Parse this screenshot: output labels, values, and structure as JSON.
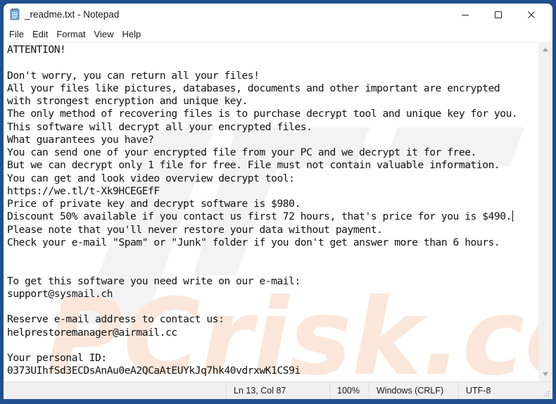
{
  "window": {
    "title": "_readme.txt - Notepad",
    "app_icon": "notepad-icon",
    "controls": {
      "minimize": "minimize-icon",
      "maximize": "maximize-icon",
      "close": "close-icon"
    }
  },
  "menu": {
    "items": [
      "File",
      "Edit",
      "Format",
      "View",
      "Help"
    ]
  },
  "document": {
    "lines": [
      "ATTENTION!",
      "",
      "Don't worry, you can return all your files!",
      "All your files like pictures, databases, documents and other important are encrypted",
      "with strongest encryption and unique key.",
      "The only method of recovering files is to purchase decrypt tool and unique key for you.",
      "This software will decrypt all your encrypted files.",
      "What guarantees you have?",
      "You can send one of your encrypted file from your PC and we decrypt it for free.",
      "But we can decrypt only 1 file for free. File must not contain valuable information.",
      "You can get and look video overview decrypt tool:",
      "https://we.tl/t-Xk9HCEGEfF",
      "Price of private key and decrypt software is $980.",
      "Discount 50% available if you contact us first 72 hours, that's price for you is $490.",
      "Please note that you'll never restore your data without payment.",
      "Check your e-mail \"Spam\" or \"Junk\" folder if you don't get answer more than 6 hours.",
      "",
      "",
      "To get this software you need write on our e-mail:",
      "support@sysmail.ch",
      "",
      "Reserve e-mail address to contact us:",
      "helprestoremanager@airmail.cc",
      "",
      "Your personal ID:",
      "0373UIhfSd3ECDsAnAu0eA2QCaAtEUYkJq7hk40vdrxwK1CS9i"
    ],
    "caret_line_index": 13,
    "watermark_text": "PCrisk.com"
  },
  "statusbar": {
    "position": "Ln 13, Col 87",
    "zoom": "100%",
    "line_ending": "Windows (CRLF)",
    "encoding": "UTF-8"
  },
  "colors": {
    "desktop_background": "#1f4f8f",
    "window_background": "#ffffff",
    "statusbar_background": "#f0f0f0",
    "watermark_orange": "#f7d8c4",
    "watermark_gray": "#ededed"
  }
}
